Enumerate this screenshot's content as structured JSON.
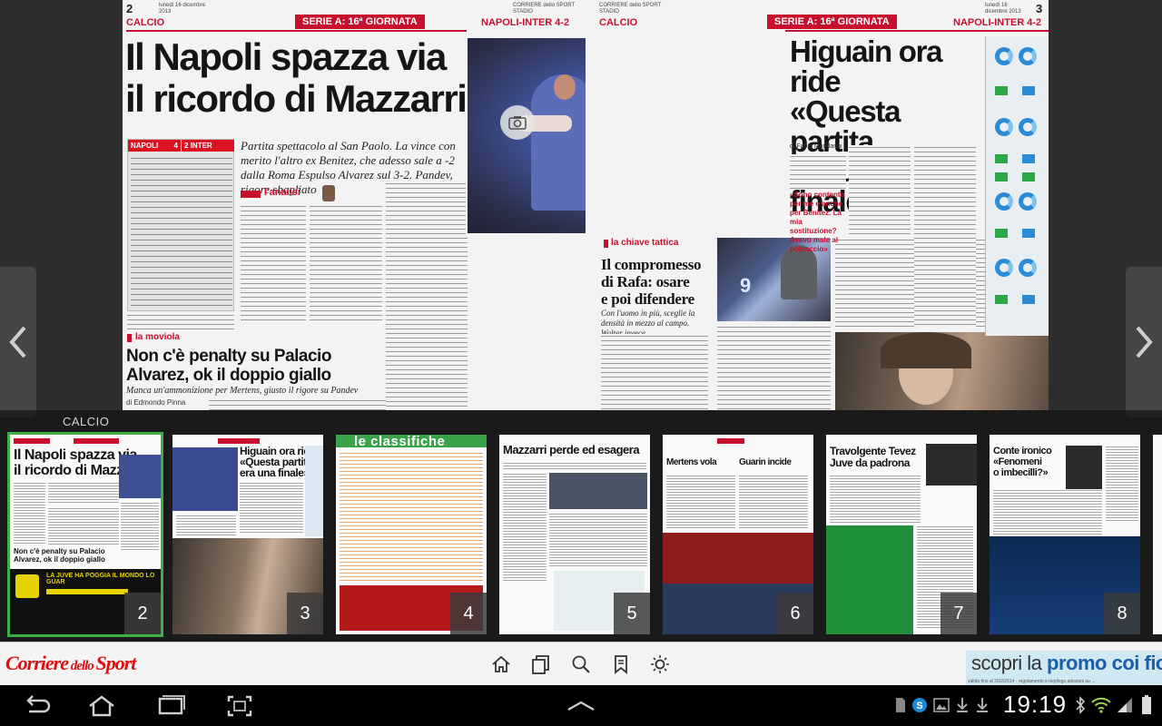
{
  "spread": {
    "left_page": {
      "page_number": "2",
      "date": "lunedì 16 dicembre 2013",
      "masthead": "CORRIERE dello SPORT STADIO",
      "section": "CALCIO",
      "tag": "SERIE A: 16ª GIORNATA",
      "match": "NAPOLI-INTER 4-2",
      "headline_1": "Il Napoli spazza via",
      "headline_2": "il ricordo di Mazzarri",
      "subhead": "Partita spettacolo al San Paolo. La vince con merito l'altro ex Benitez, che adesso sale a -2 dalla Roma Espulso Alvarez sul 3-2. Pandev, rigore sbagliato",
      "scorebox": {
        "home": "NAPOLI",
        "home_score": "4",
        "away": "INTER",
        "away_score": "2"
      },
      "analysis_label": "l'analisi",
      "kicker_moviola": "la moviola",
      "headline_moviola_1": "Non c'è penalty su Palacio",
      "headline_moviola_2": "Alvarez, ok il doppio giallo",
      "subhead_moviola": "Manca un'ammonizione per Mertens, giusto il rigore su Pandev",
      "byline_moviola": "di Edmondo Pinna",
      "kicker_chiave": "la chiave tattica",
      "headline_chiave_1": "Il compromesso",
      "headline_chiave_2": "di Rafa: osare",
      "headline_chiave_3": "e poi difendere",
      "subhead_chiave": "Con l'uomo in più, sceglie la densità in mezzo al campo. Walter invece..."
    },
    "right_page": {
      "page_number": "3",
      "date": "lunedì 16 dicembre 2013",
      "masthead": "CORRIERE dello SPORT STADIO",
      "section": "CALCIO",
      "tag": "SERIE A: 16ª GIORNATA",
      "match": "NAPOLI-INTER 4-2",
      "headline_1": "Higuain ora ride",
      "headline_2": "«Questa partita",
      "headline_3": "era una finale»",
      "byline": "di Fabio Mandarini",
      "quote": "«Sono contento per me e anche per Benitez. La mia sostituzione? Avevo male al polpaccio»"
    }
  },
  "thumbnails": {
    "section_title": "CALCIO",
    "pages": [
      {
        "number": "2",
        "headline_1": "Il Napoli spazza via",
        "headline_2": "il ricordo di Mazzarri",
        "active": true
      },
      {
        "number": "3",
        "headline_1": "Higuain ora ride",
        "headline_2": "«Questa partita",
        "headline_3": "era una finale»"
      },
      {
        "number": "4",
        "headline_1": "le classifiche"
      },
      {
        "number": "5",
        "headline_1": "Mazzarri perde ed esagera"
      },
      {
        "number": "6",
        "headline_1": "Mertens vola",
        "headline_2": "Guarin incide"
      },
      {
        "number": "7",
        "headline_1": "Travolgente Tevez",
        "headline_2": "Juve da padrona"
      },
      {
        "number": "8",
        "headline_1": "Conte ironico",
        "headline_2": "«Fenomeni",
        "headline_3": "o imbecilli?»"
      }
    ]
  },
  "toolbar": {
    "brand": "Corriere dello Sport",
    "brand_small": "dello",
    "promo_text_1": "scopri la ",
    "promo_text_2": "promo coi fiocchi",
    "promo_fine": "valida fino al 20/2/2014 - regolamento e riepilogo adesioni su ...",
    "icons": [
      "home-icon",
      "pages-icon",
      "search-icon",
      "bookmark-icon",
      "brightness-icon"
    ]
  },
  "statusbar": {
    "time": "19:19",
    "nav_icons": [
      "back-icon",
      "home-icon",
      "recent-apps-icon",
      "screenshot-icon"
    ]
  },
  "colors": {
    "accent_red": "#c8102e",
    "active_border": "#3cb043",
    "promo_blue": "#1b5da8"
  }
}
